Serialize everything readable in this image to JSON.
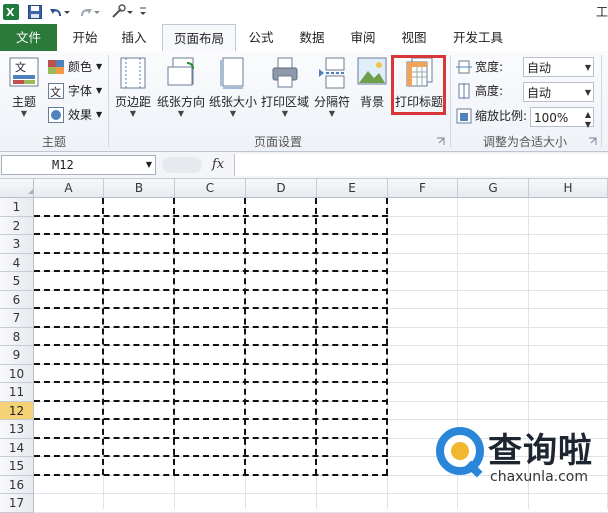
{
  "qat": {
    "title_fragment": "工"
  },
  "tabs": [
    {
      "label": "文件"
    },
    {
      "label": "开始"
    },
    {
      "label": "插入"
    },
    {
      "label": "页面布局"
    },
    {
      "label": "公式"
    },
    {
      "label": "数据"
    },
    {
      "label": "审阅"
    },
    {
      "label": "视图"
    },
    {
      "label": "开发工具"
    }
  ],
  "ribbon": {
    "theme_group": {
      "label": "主题",
      "themes_label": "主题",
      "colors_label": "颜色",
      "fonts_label": "字体",
      "effects_label": "效果"
    },
    "page_setup_group": {
      "label": "页面设置",
      "buttons": [
        {
          "label": "页边距"
        },
        {
          "label": "纸张方向"
        },
        {
          "label": "纸张大小"
        },
        {
          "label": "打印区域"
        },
        {
          "label": "分隔符"
        },
        {
          "label": "背景"
        },
        {
          "label": "打印标题"
        }
      ]
    },
    "scale_group": {
      "label": "调整为合适大小",
      "width_label": "宽度:",
      "width_value": "自动",
      "height_label": "高度:",
      "height_value": "自动",
      "scale_label": "缩放比例:",
      "scale_value": "100%"
    }
  },
  "formula_bar": {
    "name_box": "M12",
    "fx": "fx",
    "formula": ""
  },
  "sheet": {
    "columns": [
      "A",
      "B",
      "C",
      "D",
      "E",
      "F",
      "G",
      "H"
    ],
    "rows": [
      "1",
      "2",
      "3",
      "4",
      "5",
      "6",
      "7",
      "8",
      "9",
      "10",
      "11",
      "12",
      "13",
      "14",
      "15",
      "16",
      "17"
    ],
    "selected_row": "12"
  },
  "watermark": {
    "brand": "查询啦",
    "domain": "chaxunla.com"
  },
  "colors": {
    "file_tab": "#2b7a3a",
    "highlight_box": "#d9363a",
    "selected_row": "#f6d277"
  }
}
